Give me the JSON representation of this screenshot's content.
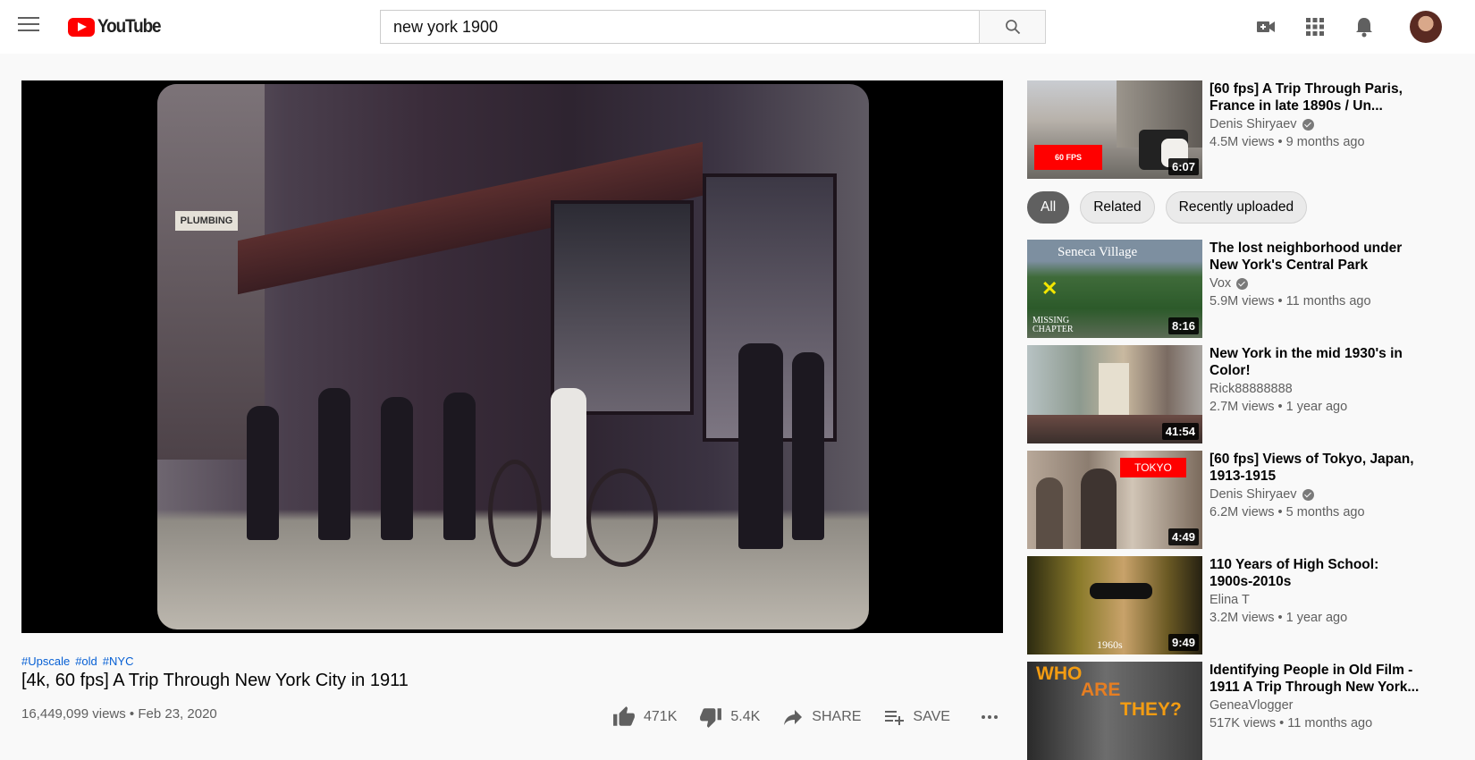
{
  "header": {
    "logo_text": "YouTube",
    "search_value": "new york 1900",
    "icons": [
      "menu-icon",
      "search-icon",
      "create-video-icon",
      "apps-grid-icon",
      "notifications-bell-icon"
    ]
  },
  "video": {
    "hashtags": [
      "#Upscale",
      "#old",
      "#NYC"
    ],
    "title": "[4k, 60 fps] A Trip Through New York City in 1911",
    "views": "16,449,099 views",
    "separator": "•",
    "date": "Feb 23, 2020",
    "actions": {
      "likes": "471K",
      "dislikes": "5.4K",
      "share": "SHARE",
      "save": "SAVE"
    },
    "frame_sign": "PLUMBING"
  },
  "sidebar": {
    "top_item": {
      "title": "[60 fps] A Trip Through Paris, France in late 1890s / Un...",
      "channel": "Denis Shiryaev",
      "verified": true,
      "stats": "4.5M views • 9 months ago",
      "duration": "6:07",
      "badge": "60 FPS"
    },
    "chips": [
      "All",
      "Related",
      "Recently uploaded"
    ],
    "active_chip": "All",
    "items": [
      {
        "title": "The lost neighborhood under New York's Central Park",
        "channel": "Vox",
        "verified": true,
        "stats": "5.9M views • 11 months ago",
        "duration": "8:16",
        "thumb_text_1": "Seneca Village",
        "thumb_text_2": "MISSING CHAPTER"
      },
      {
        "title": "New York in the mid 1930's in Color!",
        "channel": "Rick88888888",
        "verified": false,
        "stats": "2.7M views • 1 year ago",
        "duration": "41:54"
      },
      {
        "title": "[60 fps] Views of Tokyo, Japan, 1913-1915",
        "channel": "Denis Shiryaev",
        "verified": true,
        "stats": "6.2M views • 5 months ago",
        "duration": "4:49",
        "badge": "TOKYO"
      },
      {
        "title": "110 Years of High School: 1900s-2010s",
        "channel": "Elina T",
        "verified": false,
        "stats": "3.2M views • 1 year ago",
        "duration": "9:49",
        "thumb_text_1": "1960s"
      },
      {
        "title": "Identifying People in Old Film - 1911 A Trip Through New York...",
        "channel": "GeneaVlogger",
        "verified": false,
        "stats": "517K views • 11 months ago",
        "thumb_text_1": "WHO",
        "thumb_text_2": "ARE",
        "thumb_text_3": "THEY?"
      }
    ]
  }
}
